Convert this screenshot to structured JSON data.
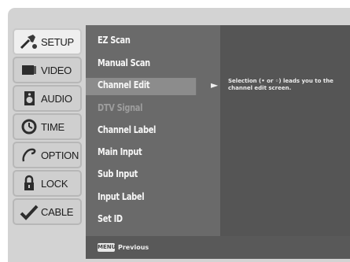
{
  "tabs": [
    {
      "label": "SETUP",
      "icon": "setup-tools-icon",
      "active": true
    },
    {
      "label": "VIDEO",
      "icon": "video-screen-icon",
      "active": false
    },
    {
      "label": "AUDIO",
      "icon": "audio-speaker-icon",
      "active": false
    },
    {
      "label": "TIME",
      "icon": "time-clock-icon",
      "active": false
    },
    {
      "label": "OPTION",
      "icon": "option-icon",
      "active": false
    },
    {
      "label": "LOCK",
      "icon": "lock-icon",
      "active": false
    },
    {
      "label": "CABLE",
      "icon": "cable-check-icon",
      "active": false
    }
  ],
  "menu": {
    "items": [
      {
        "label": "EZ Scan"
      },
      {
        "label": "Manual Scan"
      },
      {
        "label": "Channel Edit",
        "selected": true,
        "has_submenu": true
      },
      {
        "label": "DTV Signal",
        "disabled": true
      },
      {
        "label": "Channel Label"
      },
      {
        "label": "Main Input"
      },
      {
        "label": "Sub Input"
      },
      {
        "label": "Input Label"
      },
      {
        "label": "Set ID"
      }
    ],
    "submenu_arrow": "►"
  },
  "info": {
    "text": "Selection (• or ◦) leads you to the channel edit screen."
  },
  "footer": {
    "badge": "MENU",
    "label": "Previous"
  },
  "colors": {
    "menu_bg": "#6a6a6a",
    "info_bg": "#555555",
    "selected_bg": "#8c8c8c",
    "tab_bg": "#cfcfcf",
    "frame_bg": "#d3d3d3"
  }
}
